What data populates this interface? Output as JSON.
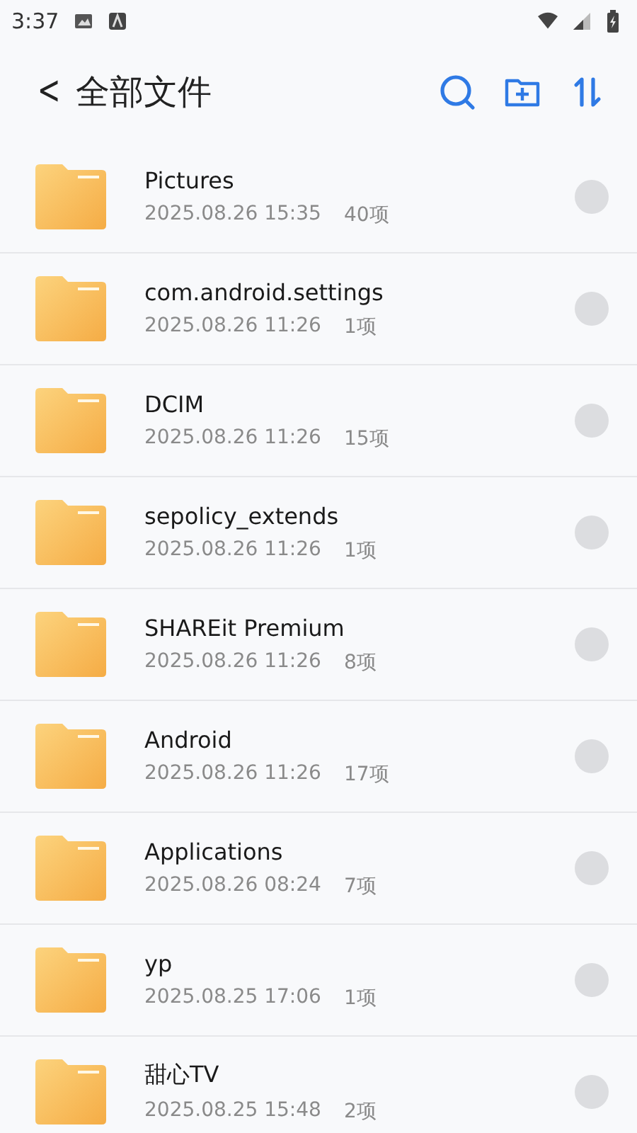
{
  "status_bar": {
    "time": "3:37"
  },
  "header": {
    "back": "<",
    "title": "全部文件"
  },
  "files": [
    {
      "name": "Pictures",
      "date": "2025.08.26 15:35",
      "count": "40项",
      "selected": false
    },
    {
      "name": "com.android.settings",
      "date": "2025.08.26 11:26",
      "count": "1项",
      "selected": false
    },
    {
      "name": "DCIM",
      "date": "2025.08.26 11:26",
      "count": "15项",
      "selected": false
    },
    {
      "name": "sepolicy_extends",
      "date": "2025.08.26 11:26",
      "count": "1项",
      "selected": false
    },
    {
      "name": "SHAREit Premium",
      "date": "2025.08.26 11:26",
      "count": "8项",
      "selected": false
    },
    {
      "name": "Android",
      "date": "2025.08.26 11:26",
      "count": "17项",
      "selected": false
    },
    {
      "name": "Applications",
      "date": "2025.08.26 08:24",
      "count": "7项",
      "selected": false
    },
    {
      "name": "yp",
      "date": "2025.08.25 17:06",
      "count": "1项",
      "selected": false
    },
    {
      "name": "甜心TV",
      "date": "2025.08.25 15:48",
      "count": "2项",
      "selected": false
    }
  ]
}
